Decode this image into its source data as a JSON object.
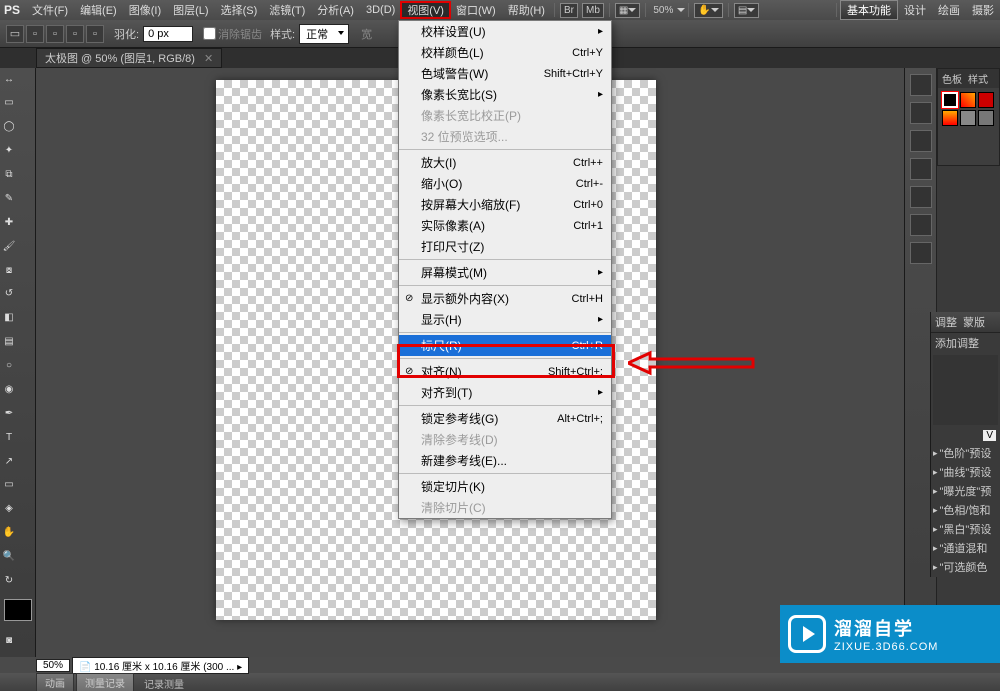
{
  "menubar": {
    "logo": "PS",
    "items": [
      "文件(F)",
      "编辑(E)",
      "图像(I)",
      "图层(L)",
      "选择(S)",
      "滤镜(T)",
      "分析(A)",
      "3D(D)",
      "视图(V)",
      "窗口(W)",
      "帮助(H)"
    ],
    "activeIndex": 8,
    "br_label": "Br",
    "mb_label": "Mb",
    "zoom": "50%",
    "right_basic": "基本功能",
    "right_links": [
      "设计",
      "绘画",
      "摄影"
    ]
  },
  "optbar": {
    "feather_label": "羽化:",
    "feather_value": "0 px",
    "antialias": "消除锯齿",
    "style_label": "样式:",
    "style_value": "正常",
    "width_label": "宽"
  },
  "doctab": {
    "name": "太极图 @ 50% (图层1, RGB/8)"
  },
  "dropdown": {
    "items": [
      {
        "label": "校样设置(U)",
        "sc": "",
        "sub": true
      },
      {
        "label": "校样颜色(L)",
        "sc": "Ctrl+Y"
      },
      {
        "label": "色域警告(W)",
        "sc": "Shift+Ctrl+Y"
      },
      {
        "label": "像素长宽比(S)",
        "sc": "",
        "sub": true
      },
      {
        "label": "像素长宽比校正(P)",
        "sc": "",
        "dis": true
      },
      {
        "label": "32 位预览选项...",
        "sc": "",
        "dis": true
      },
      {
        "sep": true
      },
      {
        "label": "放大(I)",
        "sc": "Ctrl++"
      },
      {
        "label": "缩小(O)",
        "sc": "Ctrl+-"
      },
      {
        "label": "按屏幕大小缩放(F)",
        "sc": "Ctrl+0"
      },
      {
        "label": "实际像素(A)",
        "sc": "Ctrl+1"
      },
      {
        "label": "打印尺寸(Z)",
        "sc": ""
      },
      {
        "sep": true
      },
      {
        "label": "屏幕模式(M)",
        "sc": "",
        "sub": true
      },
      {
        "sep": true
      },
      {
        "label": "显示额外内容(X)",
        "sc": "Ctrl+H",
        "check": true
      },
      {
        "label": "显示(H)",
        "sc": "",
        "sub": true
      },
      {
        "sep": true
      },
      {
        "label": "标尺(R)",
        "sc": "Ctrl+R",
        "sel": true
      },
      {
        "sep": true
      },
      {
        "label": "对齐(N)",
        "sc": "Shift+Ctrl+;",
        "check": true
      },
      {
        "label": "对齐到(T)",
        "sc": "",
        "sub": true
      },
      {
        "sep": true
      },
      {
        "label": "锁定参考线(G)",
        "sc": "Alt+Ctrl+;"
      },
      {
        "label": "清除参考线(D)",
        "sc": "",
        "dis": true
      },
      {
        "label": "新建参考线(E)...",
        "sc": ""
      },
      {
        "sep": true
      },
      {
        "label": "锁定切片(K)",
        "sc": ""
      },
      {
        "label": "清除切片(C)",
        "sc": "",
        "dis": true
      }
    ]
  },
  "adjust": {
    "tabs": [
      "调整",
      "蒙版"
    ],
    "add_label": "添加调整",
    "presets": [
      "\"色阶\"预设",
      "\"曲线\"预设",
      "\"曝光度\"预",
      "\"色相/饱和",
      "\"黑白\"预设",
      "\"通道混和",
      "\"可选颜色"
    ]
  },
  "status": {
    "zoom": "50%",
    "docinfo": "10.16 厘米 x 10.16 厘米 (300 ...",
    "tabs": [
      "动画",
      "测量记录"
    ],
    "footer": "记录测量"
  },
  "watermark": {
    "cn": "溜溜自学",
    "url": "ZIXUE.3D66.COM"
  }
}
